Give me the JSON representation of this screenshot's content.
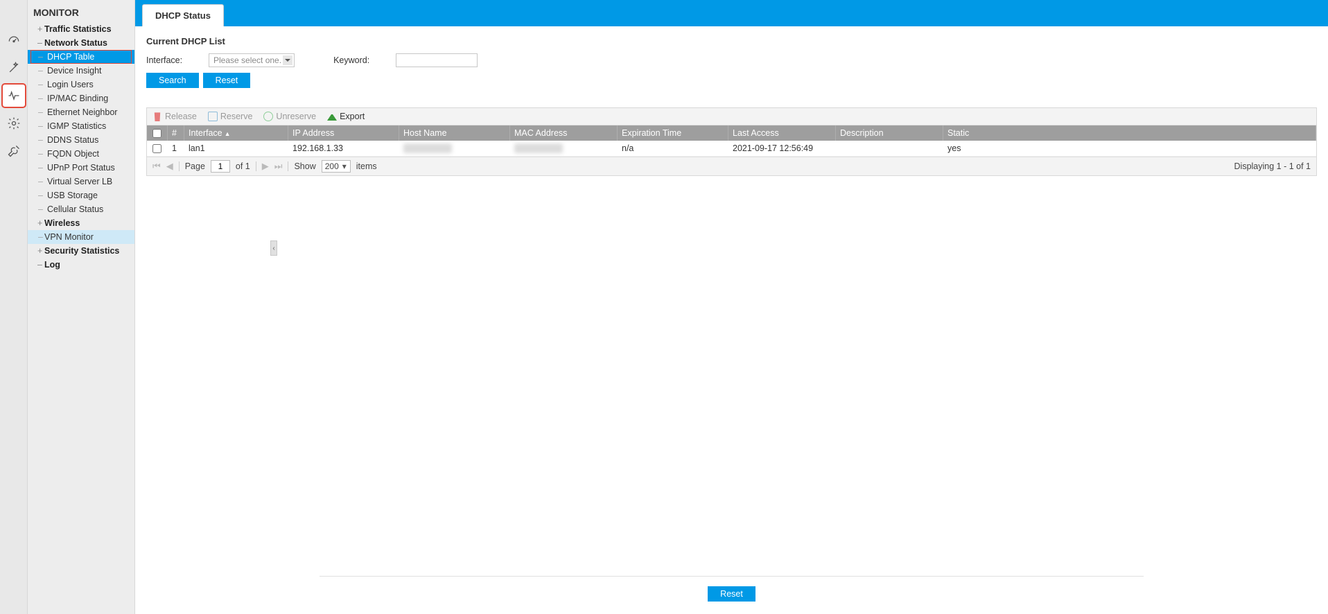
{
  "sidebar": {
    "title": "MONITOR",
    "items": [
      {
        "label": "Traffic Statistics",
        "level": 1,
        "expanded": false
      },
      {
        "label": "Network Status",
        "level": 1,
        "expanded": true,
        "children": [
          {
            "label": "DHCP Table",
            "active": true,
            "redbox": true
          },
          {
            "label": "Device Insight"
          },
          {
            "label": "Login Users"
          },
          {
            "label": "IP/MAC Binding"
          },
          {
            "label": "Ethernet Neighbor"
          },
          {
            "label": "IGMP Statistics"
          },
          {
            "label": "DDNS Status"
          },
          {
            "label": "FQDN Object"
          },
          {
            "label": "UPnP Port Status"
          },
          {
            "label": "Virtual Server LB"
          },
          {
            "label": "USB Storage"
          },
          {
            "label": "Cellular Status"
          }
        ]
      },
      {
        "label": "Wireless",
        "level": 1,
        "expanded": false
      },
      {
        "label": "VPN Monitor",
        "level": 1,
        "leaf": true,
        "highlighted": true
      },
      {
        "label": "Security Statistics",
        "level": 1,
        "expanded": false
      },
      {
        "label": "Log",
        "level": 1,
        "leaf": true
      }
    ]
  },
  "tab": {
    "label": "DHCP Status"
  },
  "section": {
    "title": "Current DHCP List"
  },
  "filters": {
    "interface_label": "Interface:",
    "interface_placeholder": "Please select one.",
    "keyword_label": "Keyword:",
    "keyword_value": ""
  },
  "buttons": {
    "search": "Search",
    "reset": "Reset",
    "footer_reset": "Reset"
  },
  "toolbar": {
    "release": "Release",
    "reserve": "Reserve",
    "unreserve": "Unreserve",
    "export": "Export"
  },
  "grid": {
    "columns": {
      "idx": "#",
      "interface": "Interface",
      "ip": "IP Address",
      "host": "Host Name",
      "mac": "MAC Address",
      "exp": "Expiration Time",
      "last": "Last Access",
      "desc": "Description",
      "static": "Static"
    },
    "rows": [
      {
        "idx": "1",
        "interface": "lan1",
        "ip": "192.168.1.33",
        "host": "",
        "mac": "",
        "exp": "n/a",
        "last": "2021-09-17 12:56:49",
        "desc": "",
        "static": "yes"
      }
    ]
  },
  "pager": {
    "page_label_pre": "Page",
    "page_value": "1",
    "page_label_post": "of 1",
    "show_label_pre": "Show",
    "show_value": "200",
    "show_label_post": "items",
    "summary": "Displaying 1 - 1 of 1"
  },
  "rail_icons": [
    "dashboard",
    "wand",
    "activity",
    "gear",
    "tools"
  ],
  "rail_selected_index": 2
}
